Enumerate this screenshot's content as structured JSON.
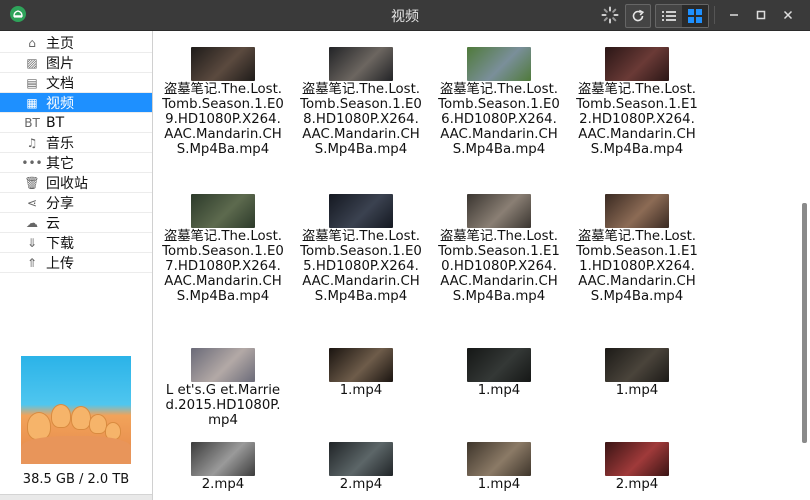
{
  "window": {
    "title": "视频"
  },
  "sidebar": {
    "items": [
      {
        "label": "主页",
        "icon": "home-icon",
        "glyph": "⌂"
      },
      {
        "label": "图片",
        "icon": "image-icon",
        "glyph": "▨"
      },
      {
        "label": "文档",
        "icon": "document-icon",
        "glyph": "▤"
      },
      {
        "label": "视频",
        "icon": "video-icon",
        "glyph": "▦"
      },
      {
        "label": "BT",
        "icon": "bt-icon",
        "glyph": "BT"
      },
      {
        "label": "音乐",
        "icon": "music-icon",
        "glyph": "♫"
      },
      {
        "label": "其它",
        "icon": "more-icon",
        "glyph": "•••"
      },
      {
        "label": "回收站",
        "icon": "trash-icon",
        "glyph": "🗑"
      },
      {
        "label": "分享",
        "icon": "share-icon",
        "glyph": "⋖"
      },
      {
        "label": "云",
        "icon": "cloud-icon",
        "glyph": "☁"
      },
      {
        "label": "下载",
        "icon": "download-icon",
        "glyph": "⇓"
      },
      {
        "label": "上传",
        "icon": "upload-icon",
        "glyph": "⇑"
      }
    ],
    "active_index": 3,
    "storage": "38.5 GB / 2.0 TB"
  },
  "files": [
    {
      "name": "盗墓笔记.The.Lost.Tomb.Season.1.E09.HD1080P.X264.AAC.Mandarin.CHS.Mp4Ba.mp4",
      "thumb": [
        "#1e1b19",
        "#5b4a3f"
      ]
    },
    {
      "name": "盗墓笔记.The.Lost.Tomb.Season.1.E08.HD1080P.X264.AAC.Mandarin.CHS.Mp4Ba.mp4",
      "thumb": [
        "#222326",
        "#6c6660"
      ]
    },
    {
      "name": "盗墓笔记.The.Lost.Tomb.Season.1.E06.HD1080P.X264.AAC.Mandarin.CHS.Mp4Ba.mp4",
      "thumb": [
        "#4f7a3a",
        "#7a8f9a"
      ]
    },
    {
      "name": "盗墓笔记.The.Lost.Tomb.Season.1.E12.HD1080P.X264.AAC.Mandarin.CHS.Mp4Ba.mp4",
      "thumb": [
        "#2a1616",
        "#6a3a36"
      ]
    },
    {
      "name": "盗墓笔记.The.Lost.Tomb.Season.1.E07.HD1080P.X264.AAC.Mandarin.CHS.Mp4Ba.mp4",
      "thumb": [
        "#2c3a2a",
        "#5d6a4e"
      ]
    },
    {
      "name": "盗墓笔记.The.Lost.Tomb.Season.1.E05.HD1080P.X264.AAC.Mandarin.CHS.Mp4Ba.mp4",
      "thumb": [
        "#141821",
        "#3b4250"
      ]
    },
    {
      "name": "盗墓笔记.The.Lost.Tomb.Season.1.E10.HD1080P.X264.AAC.Mandarin.CHS.Mp4Ba.mp4",
      "thumb": [
        "#3a3530",
        "#8a7f74"
      ]
    },
    {
      "name": "盗墓笔记.The.Lost.Tomb.Season.1.E11.HD1080P.X264.AAC.Mandarin.CHS.Mp4Ba.mp4",
      "thumb": [
        "#3a2a22",
        "#8c6b55"
      ]
    },
    {
      "name": "L et's.G et.Married.2015.HD1080P.mp4",
      "thumb": [
        "#6a6a78",
        "#b3a9a6"
      ]
    },
    {
      "name": "1.mp4",
      "thumb": [
        "#1a1410",
        "#6e5c4a"
      ]
    },
    {
      "name": "1.mp4",
      "thumb": [
        "#151716",
        "#343836"
      ]
    },
    {
      "name": "1.mp4",
      "thumb": [
        "#1c1a17",
        "#4a443b"
      ]
    },
    {
      "name": "2.mp4",
      "thumb": [
        "#3b3b3b",
        "#9a9a9a"
      ]
    },
    {
      "name": "2.mp4",
      "thumb": [
        "#202427",
        "#5c6668"
      ]
    },
    {
      "name": "1.mp4",
      "thumb": [
        "#3e352b",
        "#8b7a66"
      ]
    },
    {
      "name": "2.mp4",
      "thumb": [
        "#3a1414",
        "#a03a3a"
      ]
    }
  ]
}
